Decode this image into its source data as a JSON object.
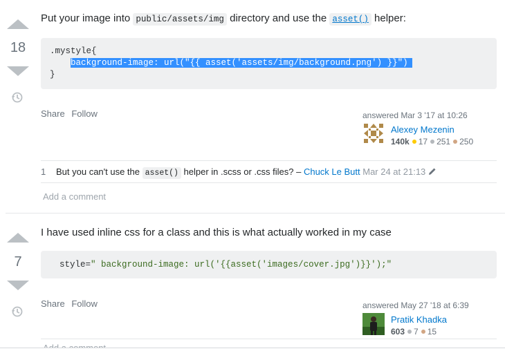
{
  "answers": [
    {
      "votes": "18",
      "text_before_1": "Put your image into ",
      "code_1": "public/assets/img",
      "text_between": " directory and use the ",
      "code_2": "asset()",
      "text_after": " helper:",
      "code_lines": [
        ".mystyle{",
        "    background-image: url(\"{{ asset('assets/img/background.png') }}\")",
        "}"
      ],
      "menu": [
        "Share",
        "Follow"
      ],
      "answered": "answered Mar 3 '17 at 10:26",
      "user": {
        "name": "Alexey Mezenin",
        "rep": "140k",
        "gold": "17",
        "silver": "251",
        "bronze": "250"
      },
      "comment": {
        "score": "1",
        "text_1": "But you can't use the ",
        "code": "asset()",
        "text_2": " helper in .scss or .css files? – ",
        "author": "Chuck Le Butt",
        "date": "Mar 24 at 21:13"
      },
      "add_comment": "Add a comment"
    },
    {
      "votes": "7",
      "text": "I have used inline css for a class and this is what actually worked in my case",
      "code_line_prefix": "style=",
      "code_line_string": "\" background-image: url('{{asset('images/cover.jpg')}}');\"",
      "menu": [
        "Share",
        "Follow"
      ],
      "answered": "answered May 27 '18 at 6:39",
      "user": {
        "name": "Pratik Khadka",
        "rep": "603",
        "silver": "7",
        "bronze": "15"
      },
      "add_comment": "Add a comment"
    }
  ],
  "colors": {
    "link": "#0077cc",
    "selection": "#3390ff",
    "code_bg": "#eff0f1"
  }
}
